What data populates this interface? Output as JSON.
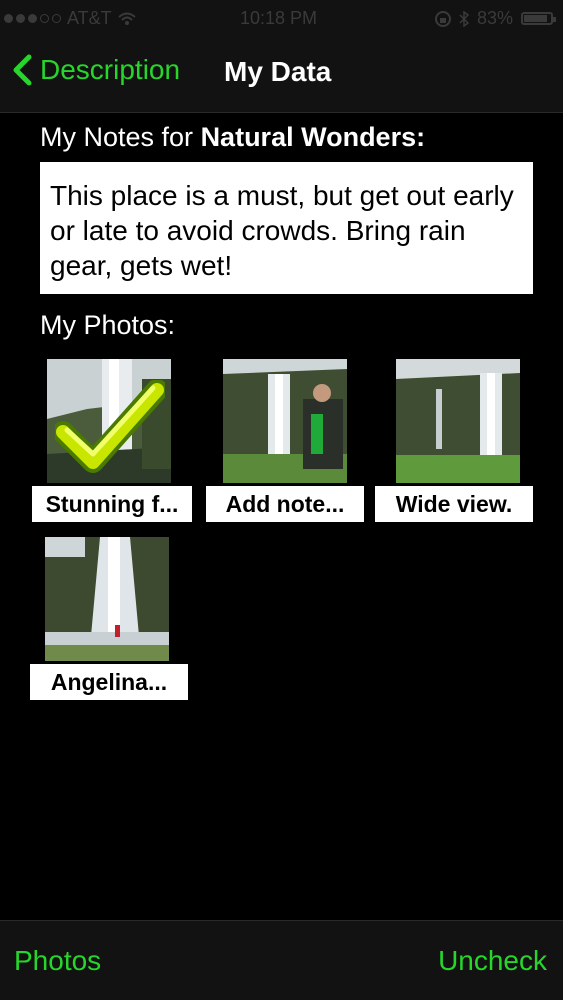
{
  "status_bar": {
    "carrier": "AT&T",
    "time": "10:18 PM",
    "battery": "83%",
    "battery_level": 0.83
  },
  "nav": {
    "back_label": "Description",
    "title": "My Data"
  },
  "notes": {
    "heading_prefix": "My Notes for",
    "heading_place": "Natural Wonders:",
    "text": "This place is a must, but get out early or late to avoid crowds. Bring rain gear, gets wet!"
  },
  "photos": {
    "heading": "My Photos:",
    "items": [
      {
        "label": "Stunning f...",
        "checked": true
      },
      {
        "label": "Add note...",
        "checked": false
      },
      {
        "label": "Wide view.",
        "checked": false
      },
      {
        "label": "Angelina...",
        "checked": false
      }
    ]
  },
  "toolbar": {
    "left_label": "Photos",
    "right_label": "Uncheck"
  },
  "colors": {
    "accent": "#27d52b",
    "background": "#000000",
    "bar": "#121212"
  }
}
